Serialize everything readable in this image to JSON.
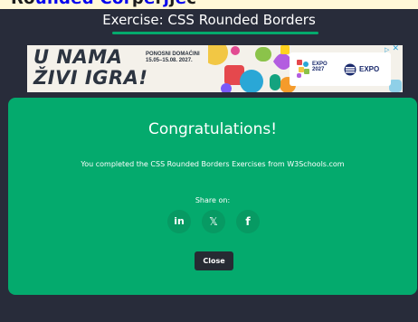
{
  "top_strip": {
    "text_dark_1": "Ro",
    "text_blue_1": "unded",
    "text_dark_2": " ",
    "text_blue_2": "Cor",
    "text_dark_3": "p",
    "text_blue_3": "e",
    "text_dark_4": "r",
    "text_blue_4": "j",
    "text_dark_5": "j",
    "text_blue_5": "e",
    "text_dark_6": "c"
  },
  "header": {
    "title": "Exercise: CSS Rounded Borders"
  },
  "ad": {
    "headline_line1": "U NAMA",
    "headline_line2": "ŽIVI IGRA!",
    "subtext_line1": "PONOSNI DOMAĆINI",
    "subtext_line2": "15.05–15.08. 2027.",
    "logo1_line1": "EXPO",
    "logo1_line2": "2027",
    "logo2": "EXPO",
    "choices_glyph": "✕",
    "choices_info": "▷"
  },
  "modal": {
    "title": "Congratulations!",
    "message": "You completed the CSS Rounded Borders Exercises from W3Schools.com",
    "share_label": "Share on:",
    "share_buttons": {
      "linkedin": "in",
      "x": "𝕏",
      "facebook": "f"
    },
    "close_label": "Close"
  },
  "colors": {
    "background": "#282c3a",
    "accent_green": "#04aa6d",
    "share_button_bg": "#079a63",
    "close_button_bg": "#262b33"
  }
}
